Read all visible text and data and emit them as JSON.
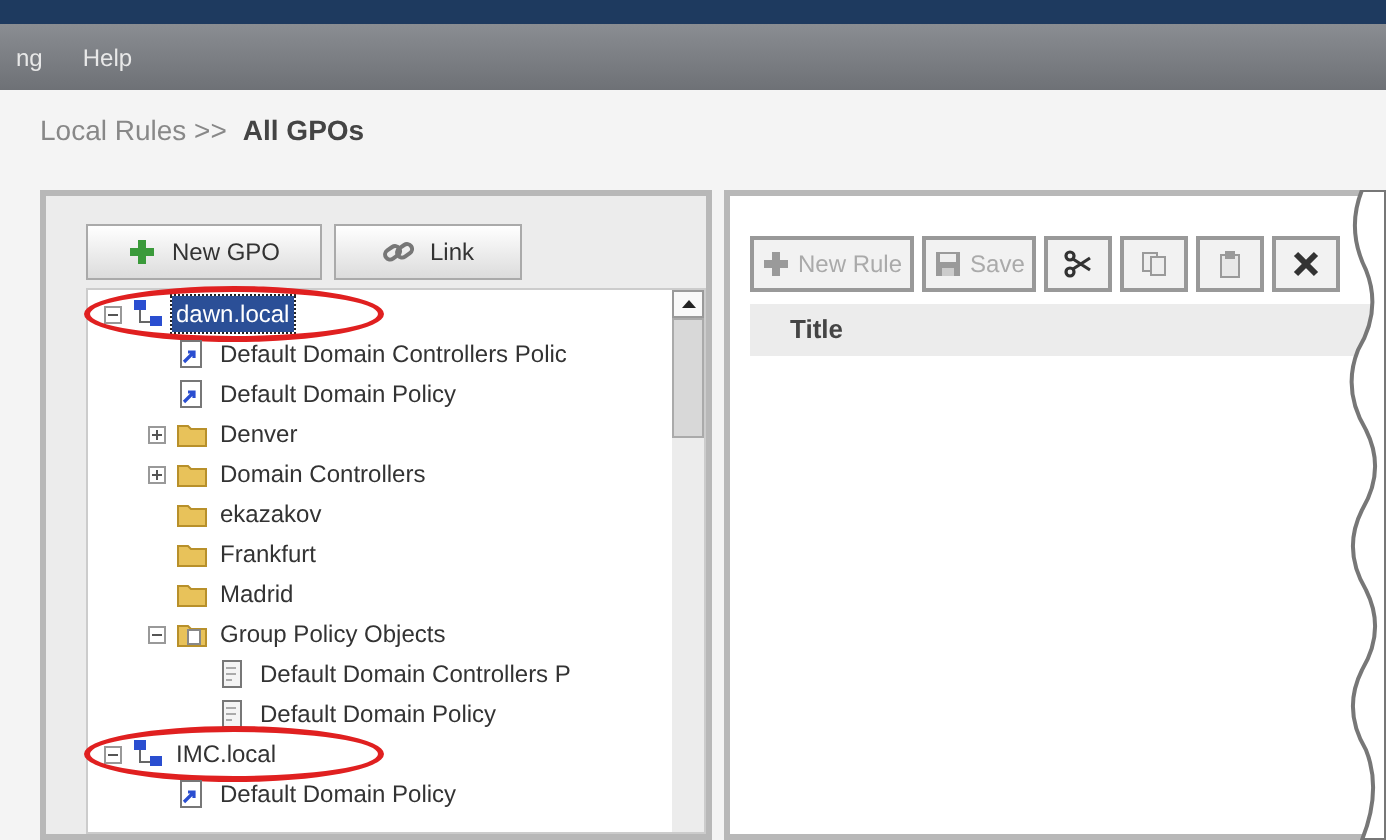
{
  "menu_bar": {
    "items": [
      "ng",
      "Help"
    ]
  },
  "breadcrumb": {
    "path": "Local Rules >>",
    "current": "All GPOs"
  },
  "left_toolbar": [
    {
      "label": "New GPO",
      "kind": "new"
    },
    {
      "label": "Link",
      "kind": "link"
    }
  ],
  "tree": [
    {
      "label": "dawn.local",
      "kind": "domain",
      "selected": true,
      "highlighted": true,
      "expanded": true,
      "children": [
        {
          "label": "Default Domain Controllers Polic",
          "kind": "gpo-link",
          "selected": false,
          "highlighted": false
        },
        {
          "label": "Default Domain Policy",
          "kind": "gpo-link",
          "selected": false,
          "highlighted": false
        },
        {
          "label": "Denver",
          "kind": "folder",
          "selected": false,
          "highlighted": false,
          "expanded": false
        },
        {
          "label": "Domain Controllers",
          "kind": "folder",
          "selected": false,
          "highlighted": false,
          "expanded": false
        },
        {
          "label": "ekazakov",
          "kind": "folder",
          "selected": false,
          "highlighted": false
        },
        {
          "label": "Frankfurt",
          "kind": "folder",
          "selected": false,
          "highlighted": false
        },
        {
          "label": "Madrid",
          "kind": "folder",
          "selected": false,
          "highlighted": false
        },
        {
          "label": "Group Policy Objects",
          "kind": "gpo-folder",
          "selected": false,
          "highlighted": false,
          "expanded": true,
          "children": [
            {
              "label": "Default Domain Controllers P",
              "kind": "gpo",
              "selected": false,
              "highlighted": false
            },
            {
              "label": "Default Domain Policy",
              "kind": "gpo",
              "selected": false,
              "highlighted": false
            }
          ]
        }
      ]
    },
    {
      "label": "IMC.local",
      "kind": "domain",
      "selected": false,
      "highlighted": true,
      "expanded": true,
      "children": [
        {
          "label": "Default Domain Policy",
          "kind": "gpo-link",
          "selected": false,
          "highlighted": false
        }
      ]
    }
  ],
  "right_toolbar": [
    {
      "label": "New Rule",
      "kind": "new",
      "disabled": true
    },
    {
      "label": "Save",
      "kind": "save",
      "disabled": true
    },
    {
      "kind": "cut",
      "disabled": false
    },
    {
      "kind": "copy",
      "disabled": true
    },
    {
      "kind": "paste",
      "disabled": true
    },
    {
      "kind": "delete",
      "disabled": false
    }
  ],
  "table": {
    "columns": [
      "Title"
    ]
  }
}
